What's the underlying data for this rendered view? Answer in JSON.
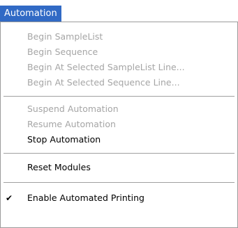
{
  "menubar": {
    "title": "Automation"
  },
  "menu": {
    "begin_samplelist": "Begin SampleList",
    "begin_sequence": "Begin Sequence",
    "begin_at_selected_samplelist_line": "Begin At Selected SampleList Line...",
    "begin_at_selected_sequence_line": "Begin At Selected Sequence Line...",
    "suspend_automation": "Suspend Automation",
    "resume_automation": "Resume Automation",
    "stop_automation": "Stop Automation",
    "reset_modules": "Reset Modules",
    "enable_automated_printing": "Enable Automated Printing",
    "check_glyph": "✔"
  },
  "state": {
    "begin_samplelist_enabled": false,
    "begin_sequence_enabled": false,
    "begin_at_selected_samplelist_line_enabled": false,
    "begin_at_selected_sequence_line_enabled": false,
    "suspend_automation_enabled": false,
    "resume_automation_enabled": false,
    "stop_automation_enabled": true,
    "reset_modules_enabled": true,
    "enable_automated_printing_checked": true
  },
  "colors": {
    "menu_highlight": "#316ac5",
    "disabled_text": "#a5a5a5",
    "enabled_text": "#000000"
  }
}
